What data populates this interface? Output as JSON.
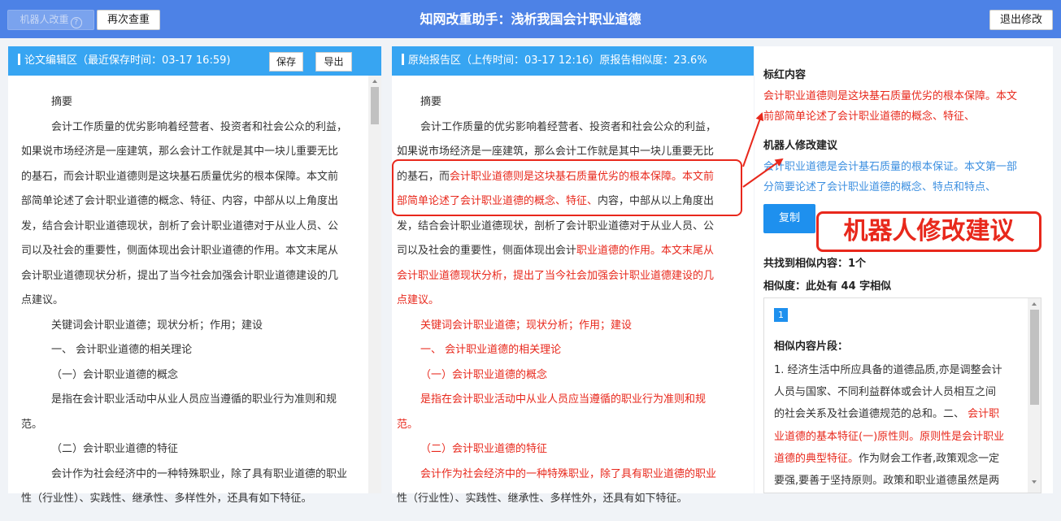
{
  "topbar": {
    "robot_rewrite_label": "机器人改重",
    "help_icon": "?",
    "recheck_label": "再次查重",
    "title": "知网改重助手：浅析我国会计职业道德",
    "exit_label": "退出修改"
  },
  "editor": {
    "header": "论文编辑区（最近保存时间：03-17 16:59)",
    "save_label": "保存",
    "export_label": "导出",
    "lines": [
      "摘要",
      "会计工作质量的优劣影响着经营者、投资者和社会公众的利益，",
      "如果说市场经济是一座建筑，那么会计工作就是其中一块儿重要无比",
      "的基石，而会计职业道德则是这块基石质量优劣的根本保障。本文前",
      "部简单论述了会计职业道德的概念、特征、内容，中部从以上角度出",
      "发，结合会计职业道德现状，剖析了会计职业道德对于从业人员、公",
      "司以及社会的重要性，侧面体现出会计职业道德的作用。本文末尾从",
      "会计职业道德现状分析，提出了当今社会加强会计职业道德建设的几",
      "点建议。",
      "关键词会计职业道德；现状分析；作用；建设",
      "一、 会计职业道德的相关理论",
      "（一）会计职业道德的概念",
      "是指在会计职业活动中从业人员应当遵循的职业行为准则和规",
      "范。",
      "（二）会计职业道德的特征",
      "会计作为社会经济中的一种特殊职业，除了具有职业道德的职业",
      "性（行业性）、实践性、继承性、多样性外，还具有如下特征。"
    ]
  },
  "report": {
    "header": "原始报告区（上传时间：03-17 12:16）原报告相似度：23.6%",
    "l0": "摘要",
    "l1": "会计工作质量的优劣影响着经营者、投资者和社会公众的利益，",
    "l2": "如果说市场经济是一座建筑，那么会计工作就是其中一块儿重要无比",
    "l3a": "的基石，而",
    "l3b": "会计职业道德则是这块基石质量优劣的根本保障。本文前",
    "l4a": "部简单论述了会计职业道德的概念、特征、",
    "l4b": "内容，中部从以上角度出",
    "l5": "发，结合会计职业道德现状，剖析了会计职业道德对于从业人员、公",
    "l6a": "司以及社会的重要性，侧面体现出会计",
    "l6b": "职业道德的作用。本文末尾从",
    "l7": "会计职业道德现状分析，提出了当今社会加强会计职业道德建设的几",
    "l8": "点建议。",
    "l9": "关键词会计职业道德；现状分析；作用；建设",
    "l10": "一、 会计职业道德的相关理论",
    "l11": "（一）会计职业道德的概念",
    "l12a": "是指在会计职业活动中从业人员应当遵循的",
    "l12b": "职业行为准则和规",
    "l13": "范。",
    "l14": "（二）会计职业道德的特征",
    "l15a": "会计作为社会经济中的一种特殊职业，除了具有",
    "l15b": "职业道德的职业",
    "l16": "性（行业性）、实践性、继承性、多样性外，还具有如下特征。"
  },
  "sidebar": {
    "marked_title": "标红内容",
    "marked_line1": "会计职业道德则是这块基石质量优劣的根本保障。本文",
    "marked_line2": "前部简单论述了会计职业道德的概念、特征、",
    "suggest_title": "机器人修改建议",
    "suggest_line1": "会计职业道德是会计基石质量的根本保证。本文第一部",
    "suggest_line2": "分简要论述了会计职业道德的概念、特点和特点、",
    "copy_label": "复制",
    "callout": "机器人修改建议",
    "found_label": "共找到相似内容：1个",
    "similarity_label": "相似度：此处有 44 字相似",
    "item_number": "1",
    "snippet_title": "相似内容片段：",
    "snippet_lines": [
      {
        "a": "1. 经济生活中所应具备的道德品质,亦是调整会计",
        "b": ""
      },
      {
        "a": "人员与国家、不同利益群体或会计人员相互之间",
        "b": ""
      },
      {
        "a": "的社会关系及社会道德规范的总和。二、",
        "b": "会计职"
      },
      {
        "a": "",
        "b": "业道德的基本特征(一)原性则。原则性是会计职业"
      },
      {
        "a": "",
        "b": "道德的典型特征。"
      },
      {
        "a": "要强,要善于坚持原则。政策和职业道德虽然是两",
        "b": ""
      }
    ],
    "snippet_tail": "作为财会工作者,政策观念一定"
  },
  "colors": {
    "topbar": "#4d82e6",
    "panel_header": "#37a5f2",
    "highlight_red": "#e8281c",
    "suggest_blue": "#3c8fe0",
    "copy_button": "#1e90ee"
  }
}
